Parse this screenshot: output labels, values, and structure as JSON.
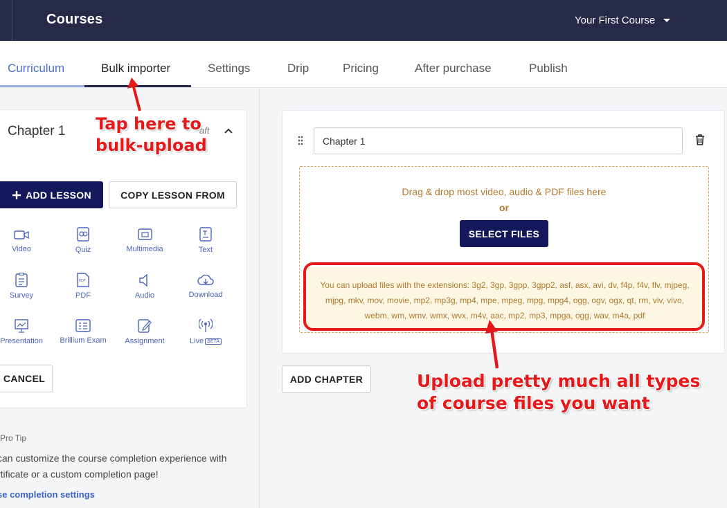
{
  "header": {
    "title": "Courses",
    "course_select": "Your First Course"
  },
  "tabs": [
    {
      "label": "Curriculum"
    },
    {
      "label": "Bulk importer"
    },
    {
      "label": "Settings"
    },
    {
      "label": "Drip"
    },
    {
      "label": "Pricing"
    },
    {
      "label": "After purchase"
    },
    {
      "label": "Publish"
    }
  ],
  "left_panel": {
    "chapter_title": "Chapter 1",
    "status_partial": "aft",
    "add_lesson_label": "ADD LESSON",
    "copy_lesson_label": "COPY LESSON FROM",
    "lesson_types": [
      {
        "label": "Video",
        "icon": "video-icon"
      },
      {
        "label": "Quiz",
        "icon": "quiz-icon"
      },
      {
        "label": "Multimedia",
        "icon": "multimedia-icon"
      },
      {
        "label": "Text",
        "icon": "text-icon"
      },
      {
        "label": "Survey",
        "icon": "survey-icon"
      },
      {
        "label": "PDF",
        "icon": "pdf-icon"
      },
      {
        "label": "Audio",
        "icon": "audio-icon"
      },
      {
        "label": "Download",
        "icon": "download-icon"
      },
      {
        "label": "Presentation",
        "icon": "presentation-icon"
      },
      {
        "label": "Brillium Exam",
        "icon": "exam-icon"
      },
      {
        "label": "Assignment",
        "icon": "assignment-icon"
      },
      {
        "label": "Live",
        "icon": "live-icon",
        "badge": "BETA"
      }
    ],
    "cancel_label": "CANCEL",
    "protip_heading": "Pro Tip",
    "protip_line1": "can customize the course completion experience with",
    "protip_line2": "rtificate or a custom completion page!",
    "protip_link": "se completion settings"
  },
  "editor": {
    "chapter_name_value": "Chapter 1",
    "drop_text": "Drag & drop most video, audio & PDF files here",
    "or_text": "or",
    "select_files_label": "SELECT FILES",
    "extensions_text": "You can upload files with the extensions: 3g2, 3gp, 3gpp, 3gpp2, asf, asx, avi, dv, f4p, f4v, flv, mjpeg, mjpg, mkv, mov, movie, mp2, mp3g, mp4, mpe, mpeg, mpg, mpg4, ogg, ogv, ogx, qt, rm, viv, vivo, webm, wm, wmv, wmx, wvx, m4v, aac, mp2, mp3, mpga, ogg, wav, m4a, pdf",
    "add_chapter_label": "ADD CHAPTER"
  },
  "annotations": {
    "bulk_line1": "Tap here to",
    "bulk_line2": "bulk-upload",
    "upload_line1": "Upload pretty much all types",
    "upload_line2": "of course files you want"
  },
  "colors": {
    "navy": "#262a48",
    "button_navy": "#13185a",
    "accent_blue": "#4a70c9",
    "annotation_red": "#e5191a",
    "drop_text": "#b07a2c"
  }
}
